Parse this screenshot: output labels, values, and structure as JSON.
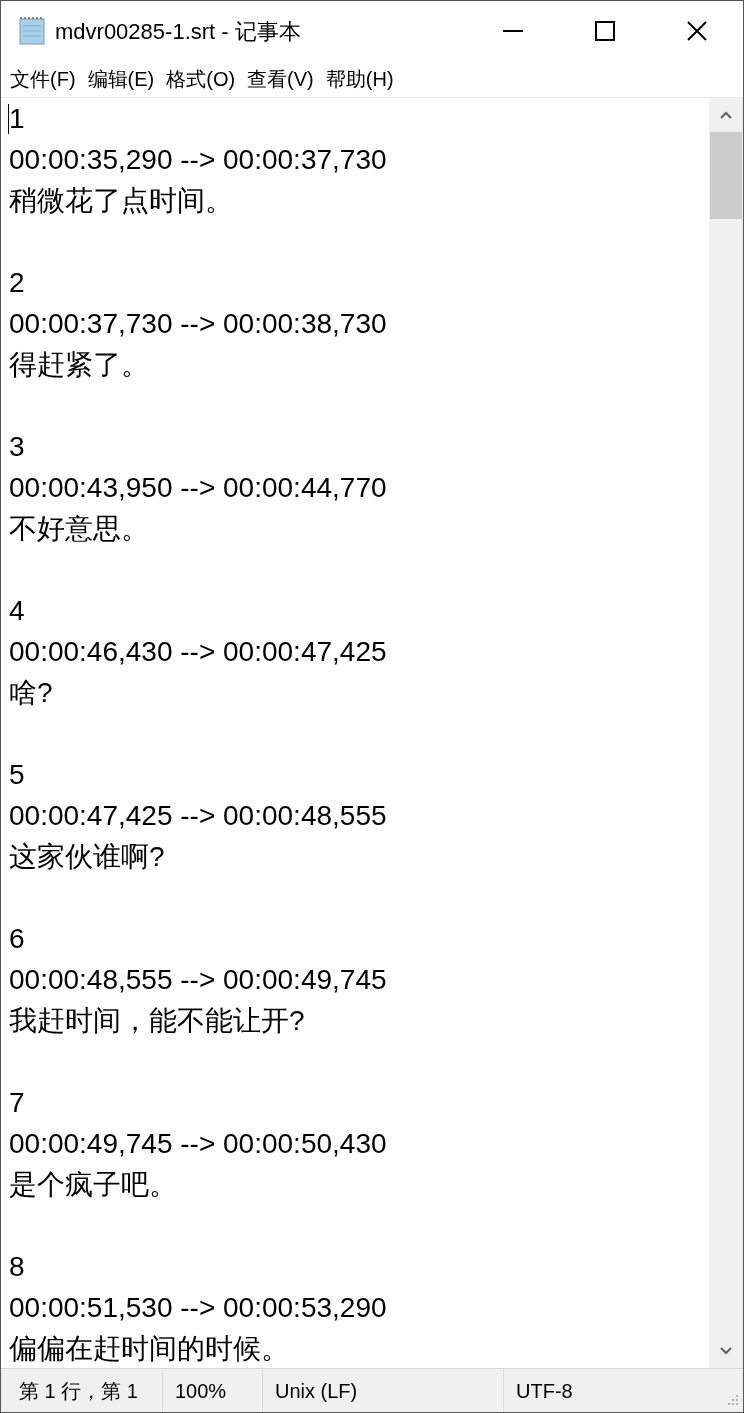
{
  "window": {
    "title": "mdvr00285-1.srt - 记事本"
  },
  "menu": [
    "文件(F)",
    "编辑(E)",
    "格式(O)",
    "查看(V)",
    "帮助(H)"
  ],
  "entries": [
    {
      "index": "1",
      "time": "00:00:35,290 --> 00:00:37,730",
      "text": "稍微花了点时间。"
    },
    {
      "index": "2",
      "time": "00:00:37,730 --> 00:00:38,730",
      "text": "得赶紧了。"
    },
    {
      "index": "3",
      "time": "00:00:43,950 --> 00:00:44,770",
      "text": "不好意思。"
    },
    {
      "index": "4",
      "time": "00:00:46,430 --> 00:00:47,425",
      "text": "啥?"
    },
    {
      "index": "5",
      "time": "00:00:47,425 --> 00:00:48,555",
      "text": "这家伙谁啊?"
    },
    {
      "index": "6",
      "time": "00:00:48,555 --> 00:00:49,745",
      "text": "我赶时间，能不能让开?"
    },
    {
      "index": "7",
      "time": "00:00:49,745 --> 00:00:50,430",
      "text": "是个疯子吧。"
    },
    {
      "index": "8",
      "time": "00:00:51,530 --> 00:00:53,290",
      "text": "偏偏在赶时间的时候。"
    }
  ],
  "status_bar": {
    "position": "第 1 行，第 1",
    "zoom": "100%",
    "line_ending": "Unix (LF)",
    "encoding": "UTF-8"
  }
}
